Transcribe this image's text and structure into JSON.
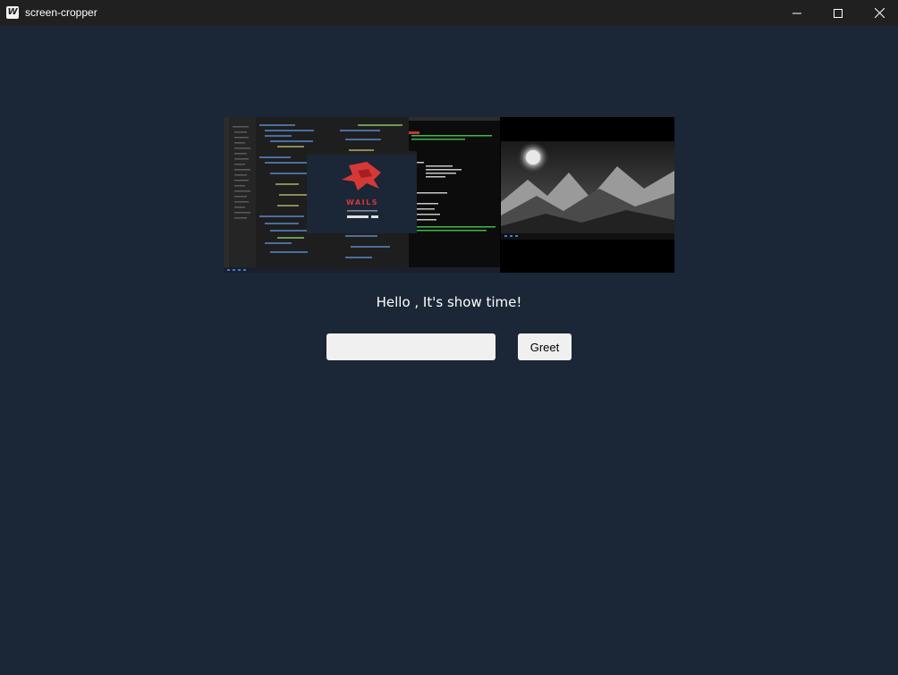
{
  "window": {
    "title": "screen-cropper",
    "icon": "wails-w-icon",
    "controls": [
      "minimize-icon",
      "maximize-icon",
      "close-icon"
    ]
  },
  "preview": {
    "logo_text": "WAILS"
  },
  "greeting": {
    "result_text": "Hello , It's show time!",
    "input_value": "",
    "input_placeholder": "",
    "button_label": "Greet"
  },
  "colors": {
    "background": "#1b2636",
    "titlebar": "#202020",
    "accent_red": "#d63838"
  }
}
